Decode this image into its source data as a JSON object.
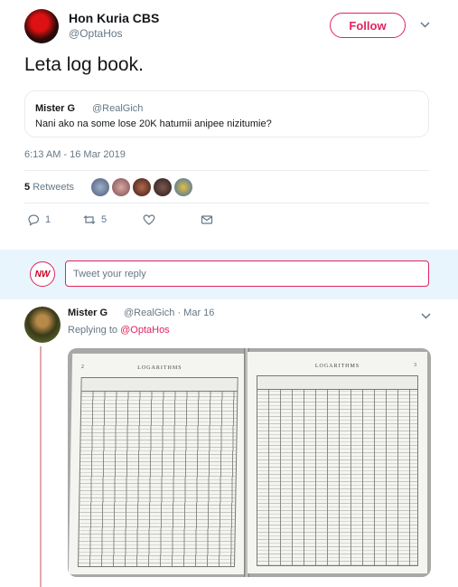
{
  "tweet": {
    "author_name": "Hon Kuria CBS",
    "author_handle": "@OptaHos",
    "follow_label": "Follow",
    "text": "Leta log book.",
    "timestamp": "6:13 AM - 16 Mar 2019",
    "retweet_count": "5",
    "retweet_label": "Retweets",
    "reply_count": "1",
    "retweet_action_count": "5"
  },
  "quoted": {
    "name": "Mister G",
    "handle": "@RealGich",
    "text": "Nani ako na some lose 20K hatumii anipee nizitumie?"
  },
  "reply_box": {
    "avatar_text": "NW",
    "placeholder": "Tweet your reply"
  },
  "reply": {
    "name": "Mister G",
    "meta": "@RealGich · Mar 16",
    "replying_prefix": "Replying to",
    "replying_to": "@OptaHos",
    "photo": {
      "left_page_number": "2",
      "right_page_number": "3",
      "left_title": "LOGARITHMS",
      "right_title": "LOGARITHMS"
    }
  },
  "colors": {
    "accent": "#e0245e",
    "muted": "#657786",
    "band": "#e8f5fd"
  },
  "icons": [
    "chevron-down-icon",
    "reply-icon",
    "retweet-icon",
    "like-icon",
    "message-icon"
  ]
}
